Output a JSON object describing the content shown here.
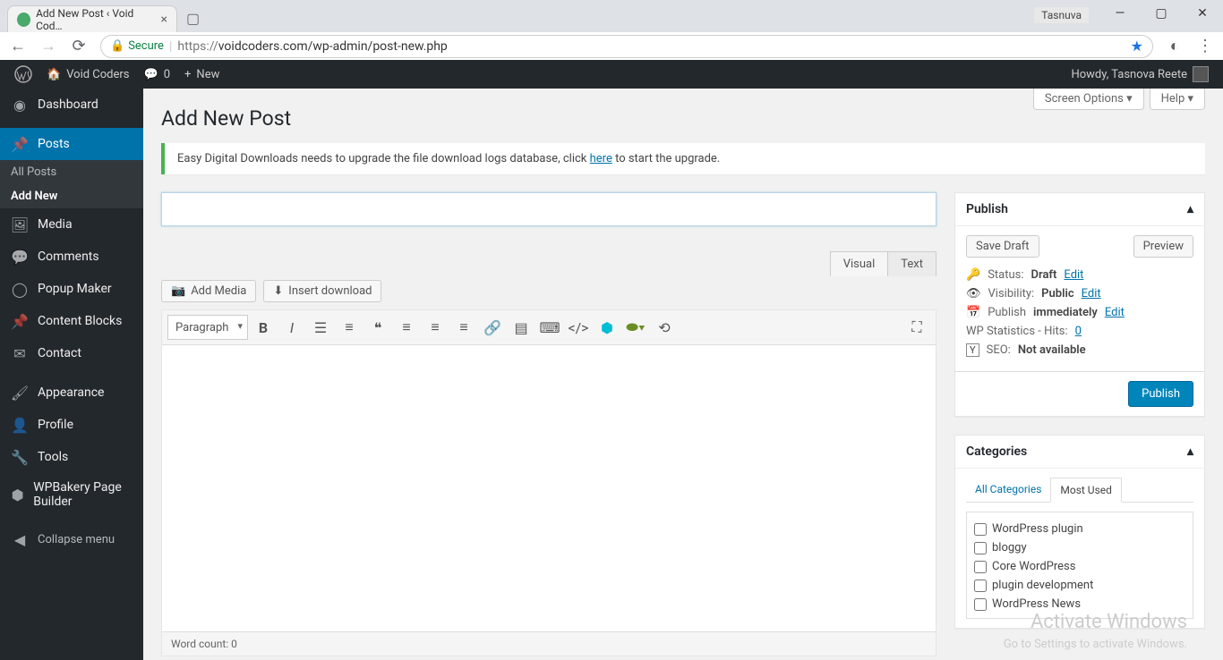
{
  "browser": {
    "tab_title": "Add New Post ‹ Void Cod…",
    "profile_name": "Tasnuva",
    "secure_label": "Secure",
    "url_prefix": "https://",
    "url_rest": "voidcoders.com/wp-admin/post-new.php"
  },
  "adminbar": {
    "site_name": "Void Coders",
    "comments_count": "0",
    "new_label": "New",
    "howdy": "Howdy, Tasnova Reete"
  },
  "sidebar": {
    "dashboard": "Dashboard",
    "posts": "Posts",
    "posts_submenu": {
      "all": "All Posts",
      "add": "Add New"
    },
    "media": "Media",
    "comments": "Comments",
    "popup_maker": "Popup Maker",
    "content_blocks": "Content Blocks",
    "contact": "Contact",
    "appearance": "Appearance",
    "profile": "Profile",
    "tools": "Tools",
    "wpbakery": "WPBakery Page Builder",
    "collapse": "Collapse menu"
  },
  "screen": {
    "options": "Screen Options",
    "help": "Help"
  },
  "page": {
    "title": "Add New Post",
    "notice_pre": "Easy Digital Downloads needs to upgrade the file download logs database, click ",
    "notice_link": "here",
    "notice_post": " to start the upgrade.",
    "title_placeholder": "",
    "add_media": "Add Media",
    "insert_download": "Insert download",
    "tab_visual": "Visual",
    "tab_text": "Text",
    "format_select": "Paragraph",
    "word_count": "Word count: 0"
  },
  "publish": {
    "heading": "Publish",
    "save_draft": "Save Draft",
    "preview": "Preview",
    "status_label": "Status:",
    "status_value": "Draft",
    "visibility_label": "Visibility:",
    "visibility_value": "Public",
    "publish_label": "Publish",
    "publish_value": "immediately",
    "edit": "Edit",
    "stats_label": "WP Statistics - Hits:",
    "stats_value": "0",
    "seo_label": "SEO:",
    "seo_value": "Not available",
    "publish_btn": "Publish"
  },
  "categories": {
    "heading": "Categories",
    "tab_all": "All Categories",
    "tab_most": "Most Used",
    "items": [
      "WordPress plugin",
      "bloggy",
      "Core WordPress",
      "plugin development",
      "WordPress News"
    ]
  },
  "watermark": {
    "line1": "Activate Windows",
    "line2": "Go to Settings to activate Windows."
  }
}
